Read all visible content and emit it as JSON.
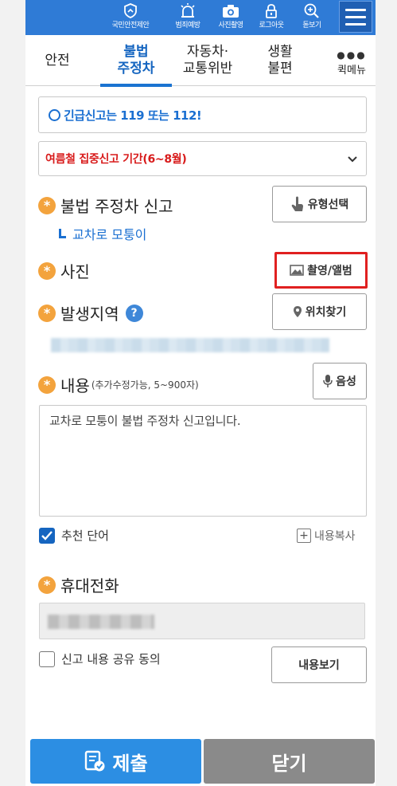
{
  "top_nav": {
    "items": [
      {
        "label": "국민안전제안",
        "icon": "shield-hand-icon"
      },
      {
        "label": "범죄예방",
        "icon": "siren-icon"
      },
      {
        "label": "사진촬영",
        "icon": "camera-icon"
      },
      {
        "label": "로그아웃",
        "icon": "lock-icon"
      },
      {
        "label": "돋보기",
        "icon": "magnifier-plus-icon"
      }
    ],
    "menu_icon": "hamburger-icon"
  },
  "tabs": [
    {
      "line1": "안전",
      "line2": ""
    },
    {
      "line1": "불법",
      "line2": "주정차"
    },
    {
      "line1": "자동차·",
      "line2": "교통위반"
    },
    {
      "line1": "생활",
      "line2": "불편"
    }
  ],
  "quick_menu": {
    "dots": "●●●",
    "label": "퀵메뉴"
  },
  "notice": {
    "text": "긴급신고는 119 또는 112!"
  },
  "season_select": {
    "text": "여름철 집중신고 기간(6~8월)"
  },
  "report_type": {
    "label": "불법 주정차 신고",
    "button": "유형선택",
    "selected": "교차로 모퉁이"
  },
  "photo": {
    "label": "사진",
    "button": "촬영/앨범"
  },
  "location": {
    "label": "발생지역",
    "help": "?",
    "button": "위치찾기"
  },
  "content": {
    "label": "내용",
    "note": "(추가수정가능, 5~900자)",
    "voice_button": "음성",
    "text": "교차로 모퉁이 불법 주정차 신고입니다."
  },
  "recommend": {
    "label": "추천 단어",
    "checked": true
  },
  "copy_content": {
    "label": "내용복사"
  },
  "phone": {
    "label": "휴대전화"
  },
  "share_consent": {
    "label": "신고 내용 공유 동의",
    "checked": false,
    "button": "내용보기"
  },
  "footer": {
    "submit": "제출",
    "close": "닫기"
  },
  "colors": {
    "primary": "#2f7bd6",
    "accent_red": "#d81b1b",
    "asterisk": "#f3a33d",
    "close_gray": "#8a8a8a"
  }
}
